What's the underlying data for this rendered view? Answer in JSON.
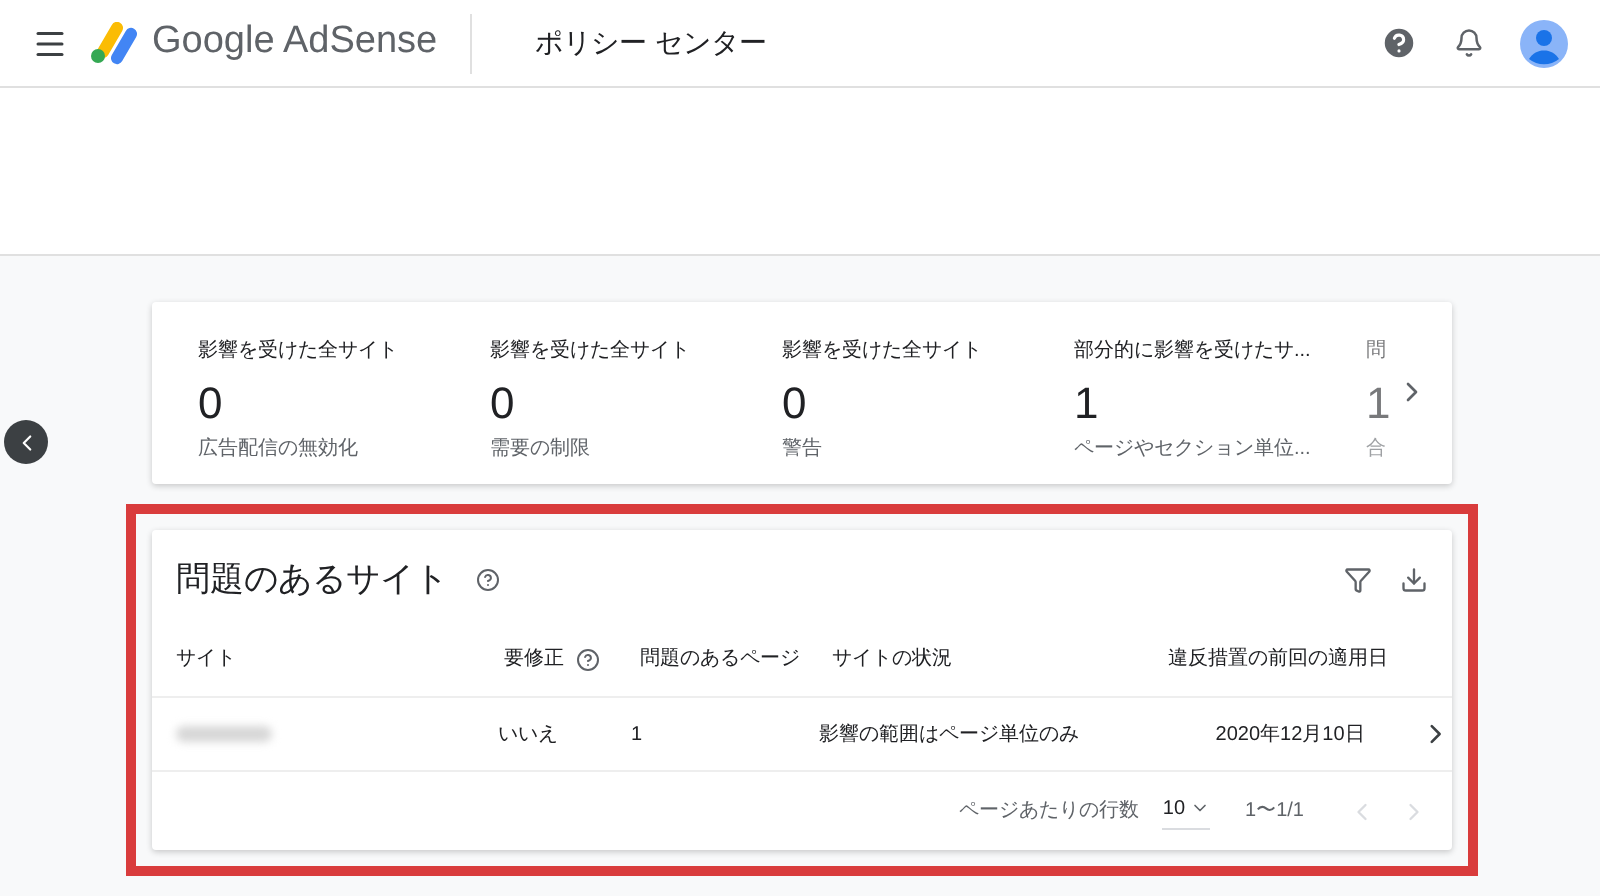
{
  "header": {
    "brand": "Google AdSense",
    "page_title": "ポリシー センター"
  },
  "summary_cards": [
    {
      "title": "影響を受けた全サイト",
      "value": "0",
      "caption": "広告配信の無効化"
    },
    {
      "title": "影響を受けた全サイト",
      "value": "0",
      "caption": "需要の制限"
    },
    {
      "title": "影響を受けた全サイト",
      "value": "0",
      "caption": "警告"
    },
    {
      "title": "部分的に影響を受けたサ...",
      "value": "1",
      "caption": "ページやセクション単位..."
    },
    {
      "title": "問",
      "value": "1",
      "caption": "合"
    }
  ],
  "sites_panel": {
    "title": "問題のあるサイト",
    "columns": [
      {
        "label": "サイト",
        "help": false
      },
      {
        "label": "要修正",
        "help": true
      },
      {
        "label": "問題のあるページ",
        "help": false
      },
      {
        "label": "サイトの状況",
        "help": false
      },
      {
        "label": "違反措置の前回の適用日",
        "help": false
      }
    ],
    "rows": [
      {
        "needs_fix": "いいえ",
        "pages": "1",
        "status": "影響の範囲はページ単位のみ",
        "date": "2020年12月10日"
      }
    ],
    "rows_per_page_label": "ページあたりの行数",
    "rows_per_page": "10",
    "range": "1〜1/1",
    "prev_disabled": true,
    "next_disabled": true
  }
}
